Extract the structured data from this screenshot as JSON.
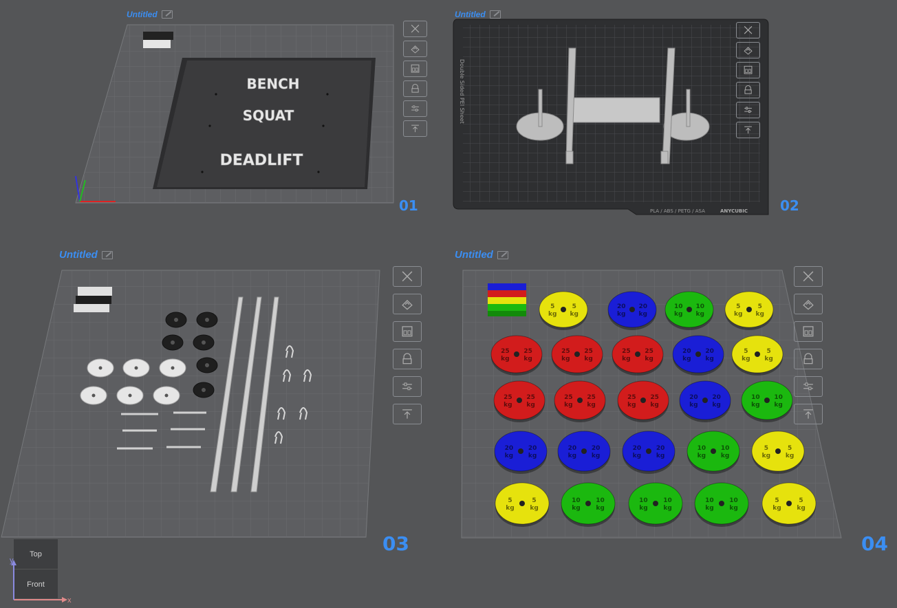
{
  "panels": [
    {
      "title": "Untitled",
      "number": "01"
    },
    {
      "title": "Untitled",
      "number": "02"
    },
    {
      "title": "Untitled",
      "number": "03"
    },
    {
      "title": "Untitled",
      "number": "04"
    }
  ],
  "sign_text": {
    "line1": "BENCH",
    "line2": "SQUAT",
    "line3": "DEADLIFT"
  },
  "printer_bed": {
    "sheet_label": "Double Sided PEI Sheet",
    "material_label": "PLA / ABS / PETG / ASA",
    "brand": "ANYCUBIC"
  },
  "toolbar_icons": [
    "close-icon",
    "arrange-icon",
    "layout-icon",
    "lock-icon",
    "settings-sliders-icon",
    "export-icon"
  ],
  "plates_04": {
    "colors": {
      "red": "#d21c1c",
      "blue": "#1a1ed6",
      "green": "#1bb80f",
      "yellow": "#e6e20d"
    },
    "rows": [
      [
        {
          "c": "yellow",
          "t": "5"
        },
        {
          "c": "blue",
          "t": "20"
        },
        {
          "c": "green",
          "t": "10"
        },
        {
          "c": "yellow",
          "t": "5"
        }
      ],
      [
        {
          "c": "red",
          "t": "25"
        },
        {
          "c": "red",
          "t": "25"
        },
        {
          "c": "red",
          "t": "25"
        },
        {
          "c": "blue",
          "t": "20"
        },
        {
          "c": "yellow",
          "t": "5"
        }
      ],
      [
        {
          "c": "red",
          "t": "25"
        },
        {
          "c": "red",
          "t": "25"
        },
        {
          "c": "red",
          "t": "25"
        },
        {
          "c": "blue",
          "t": "20"
        },
        {
          "c": "green",
          "t": "10"
        }
      ],
      [
        {
          "c": "blue",
          "t": "20"
        },
        {
          "c": "blue",
          "t": "20"
        },
        {
          "c": "blue",
          "t": "20"
        },
        {
          "c": "green",
          "t": "10"
        },
        {
          "c": "yellow",
          "t": "5"
        }
      ],
      [
        {
          "c": "yellow",
          "t": "5"
        },
        {
          "c": "green",
          "t": "10"
        },
        {
          "c": "green",
          "t": "10"
        },
        {
          "c": "green",
          "t": "10"
        },
        {
          "c": "yellow",
          "t": "5"
        }
      ]
    ],
    "unit": "kg"
  },
  "view_cube": {
    "top": "Top",
    "front": "Front",
    "axis_x": "x",
    "axis_y": "y"
  }
}
